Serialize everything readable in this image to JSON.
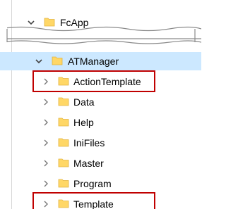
{
  "tree": {
    "root": {
      "label": "FcApp",
      "expanded": true
    },
    "parent": {
      "label": "ATManager",
      "expanded": true,
      "selected": true
    },
    "children": [
      {
        "label": "ActionTemplate",
        "highlighted": true
      },
      {
        "label": "Data"
      },
      {
        "label": "Help"
      },
      {
        "label": "IniFiles"
      },
      {
        "label": "Master"
      },
      {
        "label": "Program"
      },
      {
        "label": "Template",
        "highlighted": true
      }
    ]
  },
  "colors": {
    "selection": "#cce8ff",
    "highlight_border": "#c00000",
    "folder": "#ffd766"
  }
}
